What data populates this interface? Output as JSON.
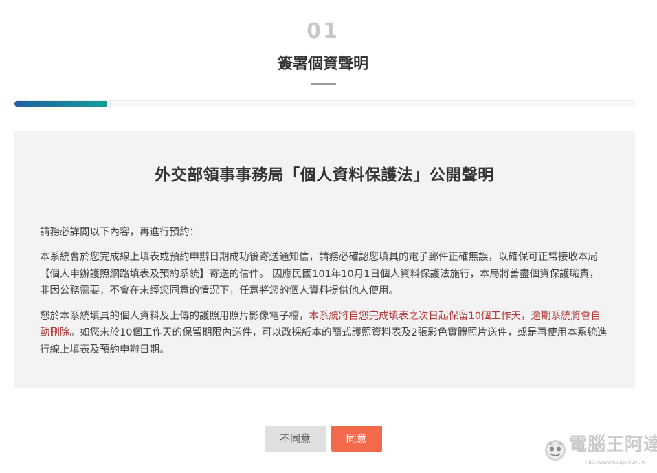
{
  "step": {
    "number": "01",
    "title": "簽署個資聲明"
  },
  "progress": {
    "fraction": 0.15,
    "track_color": "#f7f7f7",
    "fill_colors": [
      "#1f5f9e",
      "#169c9b"
    ]
  },
  "statement": {
    "title": "外交部領事事務局「個人資料保護法」公開聲明",
    "intro": "請務必詳閱以下內容，再進行預約：",
    "paragraph1": "本系統會於您完成線上填表或預約申辦日期成功後寄送通知信，請務必確認您填具的電子郵件正確無誤，以確保可正常接收本局【個人申辦護照網路填表及預約系統】寄送的信件。 因應民國101年10月1日個人資料保護法施行，本局將善盡個資保護職責，非因公務需要，不會在未經您同意的情況下，任意將您的個人資料提供他人使用。",
    "paragraph2_before": "您於本系統填具的個人資料及上傳的護照用照片影像電子檔，",
    "paragraph2_highlight": "本系統將自您完成填表之次日起保留10個工作天，逾期系統將會自動刪除",
    "paragraph2_after": "。如您未於10個工作天的保留期限內送件，可以改採紙本的簡式護照資料表及2張彩色實體照片送件，或是再使用本系統進行線上填表及預約申辦日期。",
    "highlight_color": "#b03a3a"
  },
  "actions": {
    "disagree_label": "不同意",
    "agree_label": "同意",
    "agree_color": "#f26a4b"
  },
  "watermark": {
    "text": "電腦王阿達",
    "url": "http://www.kocpc.com.tw",
    "mascot_icon": "mascot-icon"
  }
}
